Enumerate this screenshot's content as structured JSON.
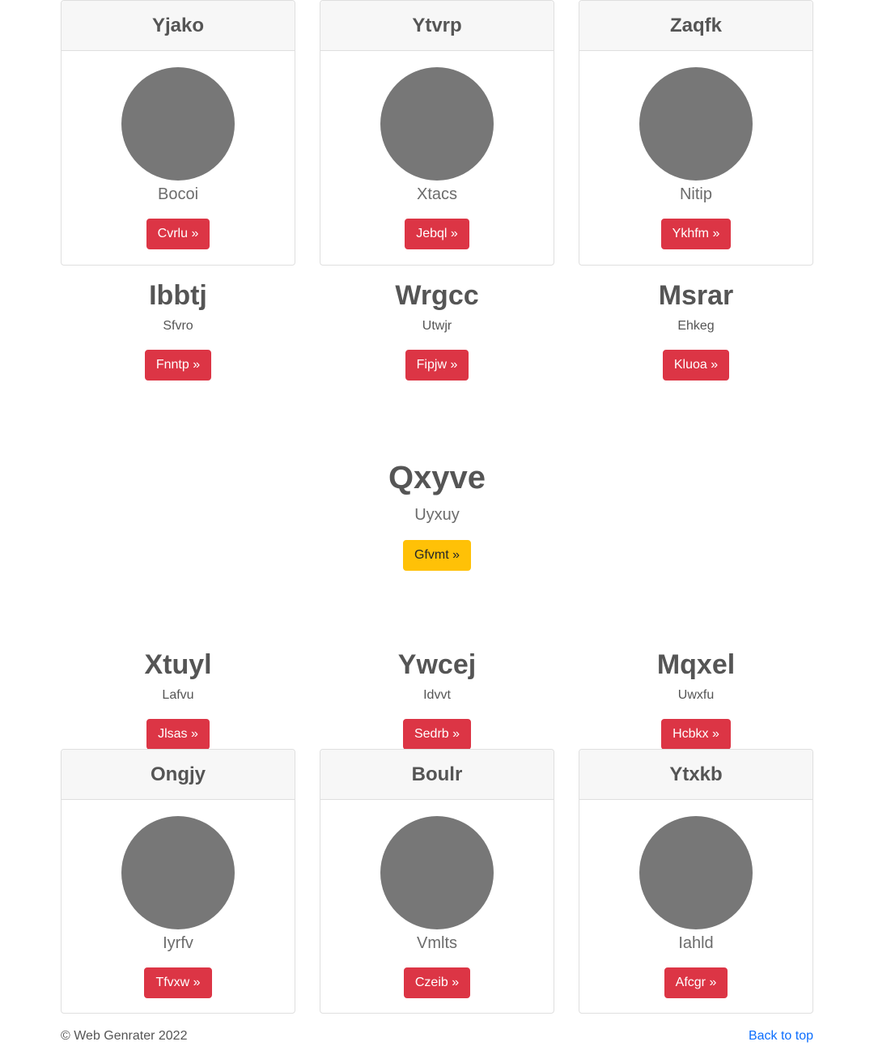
{
  "cards_top": [
    {
      "title": "Yjako",
      "subtitle": "Bocoi",
      "button": "Cvrlu »"
    },
    {
      "title": "Ytvrp",
      "subtitle": "Xtacs",
      "button": "Jebql »"
    },
    {
      "title": "Zaqfk",
      "subtitle": "Nitip",
      "button": "Ykhfm »"
    }
  ],
  "features_top": [
    {
      "title": "Ibbtj",
      "subtitle": "Sfvro",
      "button": "Fnntp »"
    },
    {
      "title": "Wrgcc",
      "subtitle": "Utwjr",
      "button": "Fipjw »"
    },
    {
      "title": "Msrar",
      "subtitle": "Ehkeg",
      "button": "Kluoa »"
    }
  ],
  "hero": {
    "title": "Qxyve",
    "subtitle": "Uyxuy",
    "button": "Gfvmt »"
  },
  "features_bottom": [
    {
      "title": "Xtuyl",
      "subtitle": "Lafvu",
      "button": "Jlsas »"
    },
    {
      "title": "Ywcej",
      "subtitle": "Idvvt",
      "button": "Sedrb »"
    },
    {
      "title": "Mqxel",
      "subtitle": "Uwxfu",
      "button": "Hcbkx »"
    }
  ],
  "cards_bottom": [
    {
      "title": "Ongjy",
      "subtitle": "Iyrfv",
      "button": "Tfvxw »"
    },
    {
      "title": "Boulr",
      "subtitle": "Vmlts",
      "button": "Czeib »"
    },
    {
      "title": "Ytxkb",
      "subtitle": "Iahld",
      "button": "Afcgr »"
    }
  ],
  "footer": {
    "copyright": "© Web Genrater 2022",
    "back_to_top": "Back to top"
  },
  "colors": {
    "danger": "#dc3545",
    "warning": "#ffc107",
    "link": "#0d6efd",
    "avatar": "#777777"
  }
}
